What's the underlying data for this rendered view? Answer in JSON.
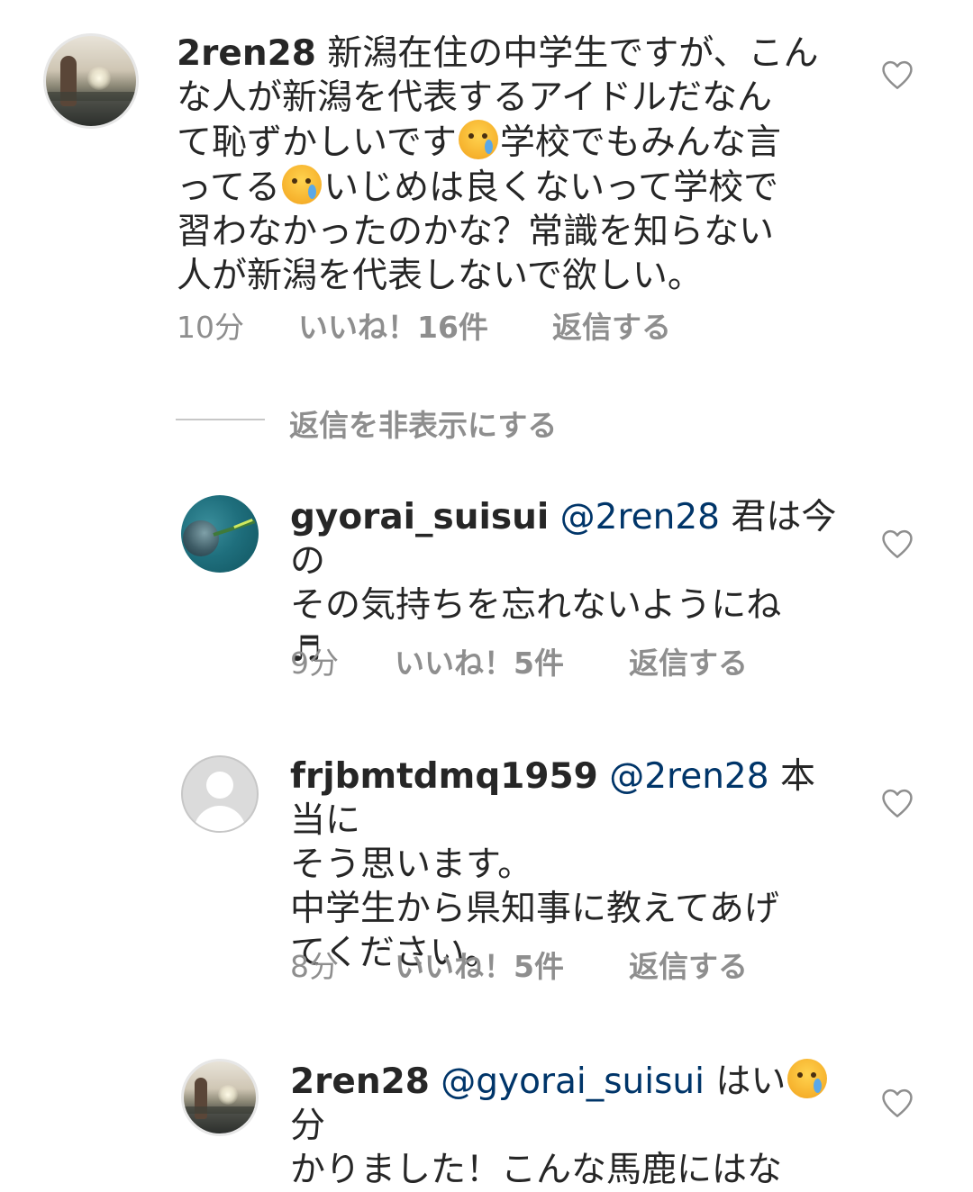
{
  "comments": [
    {
      "username": "2ren28",
      "text_lines": [
        "新潟在住の中学生ですが、こん",
        "な人が新潟を代表するアイドルだなん",
        "て恥ずかしいです",
        "学校でもみんな言",
        "ってる",
        "いじめは良くないって学校で",
        "習わなかったのかな？常識を知らない",
        "人が新潟を代表しないで欲しい。"
      ],
      "time": "10分",
      "likes": "いいね！16件",
      "reply": "返信する",
      "emoji": "crying-face"
    },
    {
      "username": "gyorai_suisui",
      "mention": "@2ren28",
      "text_a": "君は今の",
      "text_b": "その気持ちを忘れないようにね",
      "text_c": "♬",
      "time": "9分",
      "likes": "いいね！5件",
      "reply": "返信する"
    },
    {
      "username": "frjbmtdmq1959",
      "mention": "@2ren28",
      "text_a": "本当に",
      "text_b": "そう思います。",
      "text_c": "中学生から県知事に教えてあげ",
      "text_d": "てください。",
      "time": "8分",
      "likes": "いいね！5件",
      "reply": "返信する"
    },
    {
      "username": "2ren28",
      "mention": "@gyorai_suisui",
      "text_a": "はい",
      "text_b": "分",
      "text_c": "かりました！こんな馬鹿にはな",
      "emoji": "crying-face"
    }
  ],
  "hide_replies": "返信を非表示にする",
  "icons": {
    "like": "heart-outline-icon"
  },
  "colors": {
    "mention": "#003569",
    "meta": "#8e8e8e",
    "text": "#262626"
  }
}
